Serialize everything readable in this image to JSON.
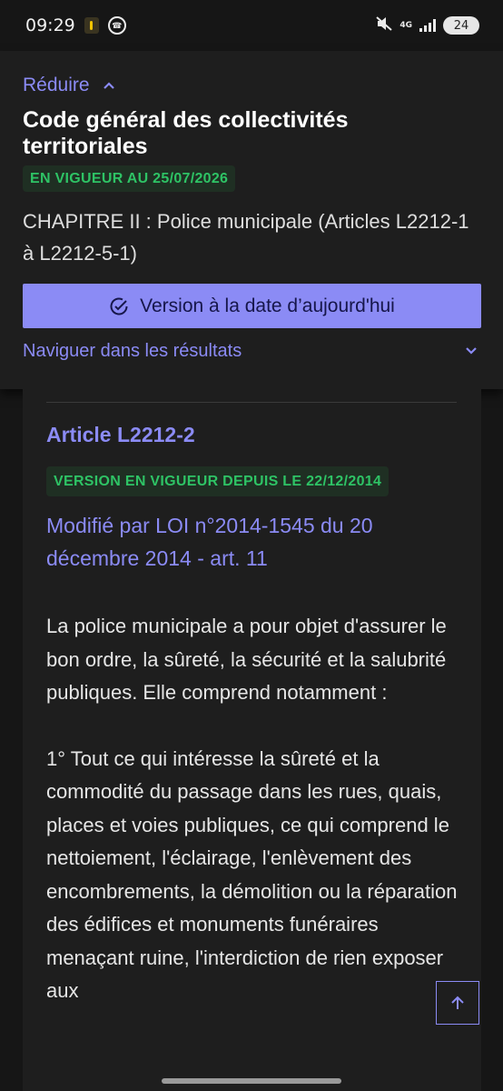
{
  "status_bar": {
    "time": "09:29",
    "network": "4G",
    "battery": "24",
    "icons": [
      "notification-icon",
      "whatsapp-icon",
      "mute-icon",
      "signal-icon",
      "battery-icon"
    ]
  },
  "header": {
    "reduce_label": "Réduire",
    "title": "Code général des collectivités territoriales",
    "status_badge": "EN VIGUEUR AU 25/07/2026",
    "chapter": "CHAPITRE II : Police municipale (Articles L2212-1 à L2212-5-1)",
    "version_button_label": "Version à la date d’aujourd'hui",
    "navigate_label": "Naviguer dans les résultats"
  },
  "article": {
    "title": "Article L2212-2",
    "status_badge": "VERSION EN VIGUEUR DEPUIS LE 22/12/2014",
    "modified_by": "Modifié par LOI n°2014-1545 du 20 décembre 2014 - art. 11",
    "paragraphs": [
      "La police municipale a pour objet d'assurer le bon ordre, la sûreté, la sécurité et la salubrité publiques. Elle comprend notamment :",
      "1° Tout ce qui intéresse la sûreté et la commodité du passage dans les rues, quais, places et voies publiques, ce qui comprend le nettoiement, l'éclairage, l'enlèvement des encombrements, la démolition ou la réparation des édifices et monuments funéraires menaçant ruine, l'interdiction de rien exposer aux"
    ]
  },
  "colors": {
    "accent": "#8b8bf5",
    "badge_text": "#2ec365",
    "badge_bg": "#1f2f23",
    "background": "#161616",
    "panel": "#1e1e1e"
  }
}
